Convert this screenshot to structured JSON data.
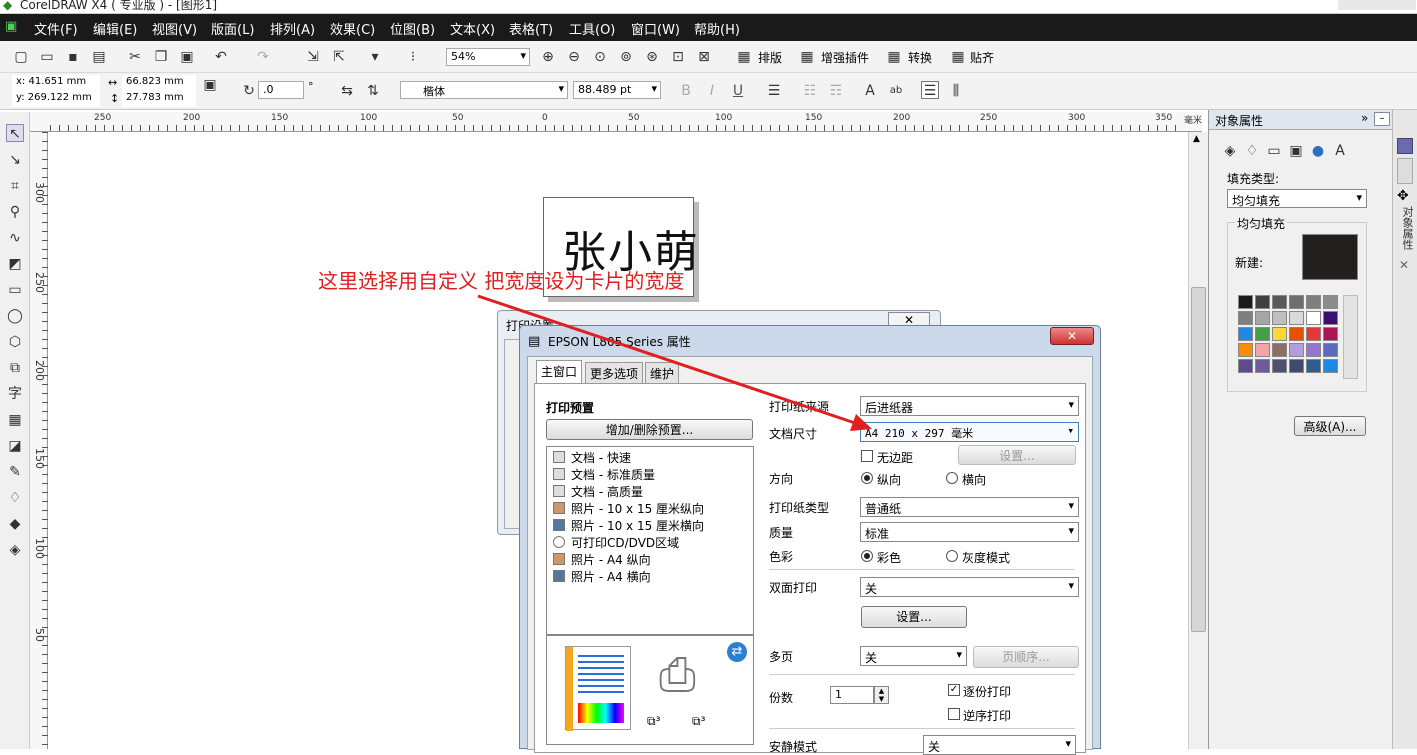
{
  "app": {
    "title": "CorelDRAW X4 ( 专业版 ) - [图形1]"
  },
  "menu": [
    "文件(F)",
    "编辑(E)",
    "视图(V)",
    "版面(L)",
    "排列(A)",
    "效果(C)",
    "位图(B)",
    "文本(X)",
    "表格(T)",
    "工具(O)",
    "窗口(W)",
    "帮助(H)"
  ],
  "toolbar": {
    "zoom": "54%",
    "paiban": "排版",
    "zengqiang": "增强插件",
    "zhuanhuan": "转换",
    "tiehe": "贴齐"
  },
  "propbar": {
    "x": "x:  41.651 mm",
    "y": "y:  269.122 mm",
    "w": "66.823 mm",
    "h": "27.783 mm",
    "angle": ".0",
    "font": "楷体",
    "fontsize": "88.489 pt"
  },
  "ruler": {
    "h": [
      "250",
      "200",
      "150",
      "100",
      "50",
      "0",
      "50",
      "100",
      "150",
      "200",
      "250",
      "300",
      "350",
      "毫米"
    ],
    "v": [
      "300",
      "250",
      "200",
      "150",
      "100",
      "50"
    ]
  },
  "card": {
    "text": "张小萌"
  },
  "annotation": "这里选择用自定义 把宽度设为卡片的宽度",
  "backdialog": {
    "title": "打印设置"
  },
  "dialog": {
    "title": "EPSON L805 Series 属性",
    "tabs": [
      "主窗口",
      "更多选项",
      "维护"
    ],
    "preset_label": "打印预置",
    "preset_button": "增加/删除预置...",
    "presets": [
      "文档 - 快速",
      "文档 - 标准质量",
      "文档 - 高质量",
      "照片 - 10 x 15 厘米纵向",
      "照片 - 10 x 15 厘米横向",
      "可打印CD/DVD区域",
      "照片 - A4 纵向",
      "照片 - A4 横向"
    ],
    "source_label": "打印纸来源",
    "source": "后进纸器",
    "size_label": "文档尺寸",
    "size": "A4 210 x 297 毫米",
    "borderless": "无边距",
    "settings_btn": "设置...",
    "orient_label": "方向",
    "portrait": "纵向",
    "landscape": "横向",
    "paper_label": "打印纸类型",
    "paper": "普通纸",
    "quality_label": "质量",
    "quality": "标准",
    "color_label": "色彩",
    "color": "彩色",
    "gray": "灰度模式",
    "duplex_label": "双面打印",
    "duplex": "关",
    "duplex_btn": "设置...",
    "multi_label": "多页",
    "multi": "关",
    "order_btn": "页顺序...",
    "copies_label": "份数",
    "copies": "1",
    "collate": "逐份打印",
    "reverse": "逆序打印",
    "quiet_label": "安静模式",
    "quiet": "关"
  },
  "docker": {
    "title": "对象属性",
    "fill_type_label": "填充类型:",
    "fill_type": "均匀填充",
    "group": "均匀填充",
    "new_label": "新建:",
    "advanced": "高级(A)...",
    "new_color": "#231f1c",
    "palette": [
      "#1a1a1a",
      "#404040",
      "#595959",
      "#6e6e6e",
      "#7f7f7f",
      "#8c8c8c",
      "#7f7f7f",
      "#a6a6a6",
      "#bfbfbf",
      "#d9d9d9",
      "#ffffff",
      "#3a0f6e",
      "#1e88e5",
      "#43a047",
      "#fdd835",
      "#e65100",
      "#e53935",
      "#ad1457",
      "#fb8c00",
      "#f4a3a8",
      "#8d6e63",
      "#b39ddb",
      "#9575cd",
      "#5c6bc0",
      "#5e4b8b",
      "#6d5c99",
      "#505070",
      "#3f4a6e",
      "#2e5e8e",
      "#1e88e5"
    ]
  },
  "righttabs": {
    "t1": "对象属性"
  }
}
